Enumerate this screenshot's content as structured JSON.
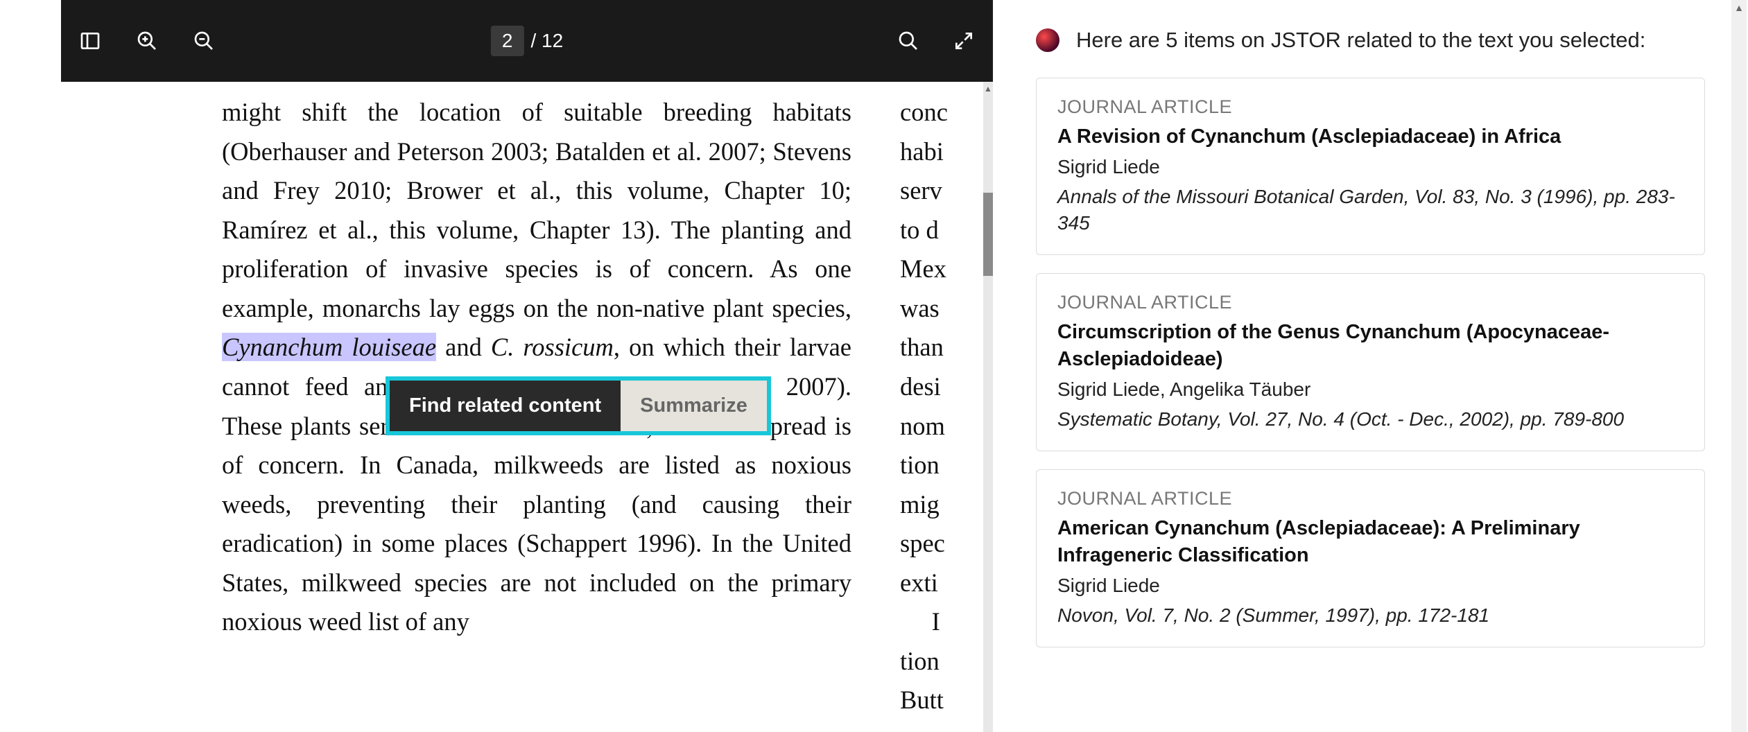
{
  "toolbar": {
    "page_current": "2",
    "page_total": "/ 12"
  },
  "popup": {
    "find_label": "Find related content",
    "summarize_label": "Summarize"
  },
  "paper": {
    "highlighted_phrase": "Cynanchum louiseae",
    "col1_pre": "might shift the location of suitable breeding habi­tats (Oberhauser and Peterson 2003; Batalden et al. 2007; Stevens and Frey 2010; Brower et al., this volume, Chapter 10; Ramírez et al., this vol­ume, Chapter 13). The planting and prolifera­tion of invasive species is of concern. As one example, monarchs lay eggs on the non-native plant species, ",
    "col1_post": " and C. rossicum, on which their larvae cannot feed and develop (Casagrande and Dacey 2007). These plants serve as sinks for monarchs, and their spread is of con­cern. In Canada, milkweeds are listed as noxious weeds, preventing their planting (and causing their eradication) in some places (Schappert 1996). In the United States, milkweed species are not included on the primary noxious weed list of any",
    "col2_lines": [
      "conc",
      "habi",
      "serv",
      "to d",
      "Mex",
      "was",
      "than",
      "desi",
      "nom",
      "tion",
      "mig",
      "spec",
      "exti",
      "     I",
      "tion",
      "Butt"
    ]
  },
  "sidebar": {
    "header": "Here are 5 items on JSTOR related to the text you selected:",
    "type_label": "JOURNAL ARTICLE",
    "results": [
      {
        "title": "A Revision of Cynanchum (Asclepiadaceae) in Africa",
        "author": "Sigrid Liede",
        "meta": "Annals of the Missouri Botanical Garden, Vol. 83, No. 3 (1996), pp. 283-345"
      },
      {
        "title": "Circumscription of the Genus Cynanchum (Apocynaceae-Asclepiadoideae)",
        "author": "Sigrid Liede, Angelika Täuber",
        "meta": "Systematic Botany, Vol. 27, No. 4 (Oct. - Dec., 2002), pp. 789-800"
      },
      {
        "title": "American Cynanchum (Asclepiadaceae): A Preliminary Infrageneric Classification",
        "author": "Sigrid Liede",
        "meta": "Novon, Vol. 7, No. 2 (Summer, 1997), pp. 172-181"
      }
    ]
  }
}
